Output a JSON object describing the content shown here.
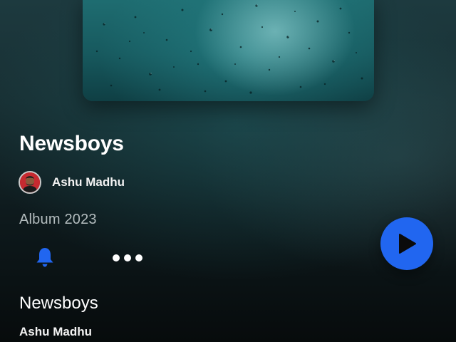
{
  "album": {
    "title": "Newsboys",
    "artist": "Ashu Madhu",
    "meta": "Album 2023",
    "cover_icon": "rain-water-cover-art",
    "avatar_icon": "artist-avatar"
  },
  "actions": {
    "bell_icon": "bell-icon",
    "more_icon": "more-horizontal-icon",
    "play_icon": "play-icon",
    "accent_color": "#2166f0"
  },
  "tracks": [
    {
      "title": "Newsboys",
      "artist": "Ashu Madhu"
    }
  ]
}
